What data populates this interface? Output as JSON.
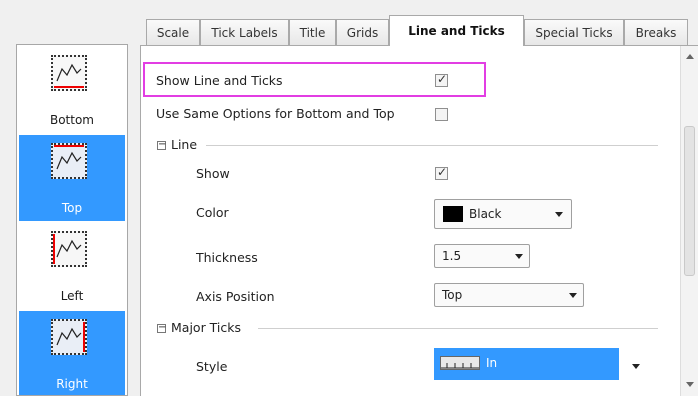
{
  "tabs": [
    {
      "label": "Scale",
      "active": false
    },
    {
      "label": "Tick Labels",
      "active": false
    },
    {
      "label": "Title",
      "active": false
    },
    {
      "label": "Grids",
      "active": false
    },
    {
      "label": "Line and Ticks",
      "active": true
    },
    {
      "label": "Special Ticks",
      "active": false
    },
    {
      "label": "Breaks",
      "active": false
    }
  ],
  "axis_list": [
    {
      "label": "Bottom",
      "selected": false
    },
    {
      "label": "Top",
      "selected": true
    },
    {
      "label": "Left",
      "selected": false
    },
    {
      "label": "Right",
      "selected": true
    }
  ],
  "options": {
    "show_line_and_ticks": {
      "label": "Show Line and Ticks",
      "checked": true
    },
    "use_same_options": {
      "label": "Use Same Options for Bottom and Top",
      "checked": false
    }
  },
  "line_group": {
    "title": "Line",
    "show_label": "Show",
    "show_checked": true,
    "color_label": "Color",
    "color_value": "Black",
    "color_swatch": "#000000",
    "thickness_label": "Thickness",
    "thickness_value": "1.5",
    "axis_position_label": "Axis Position",
    "axis_position_value": "Top"
  },
  "major_ticks_group": {
    "title": "Major Ticks",
    "style_label": "Style",
    "style_value": "In"
  },
  "colors": {
    "selection": "#3399ff",
    "highlight_border": "#e23ee3"
  }
}
